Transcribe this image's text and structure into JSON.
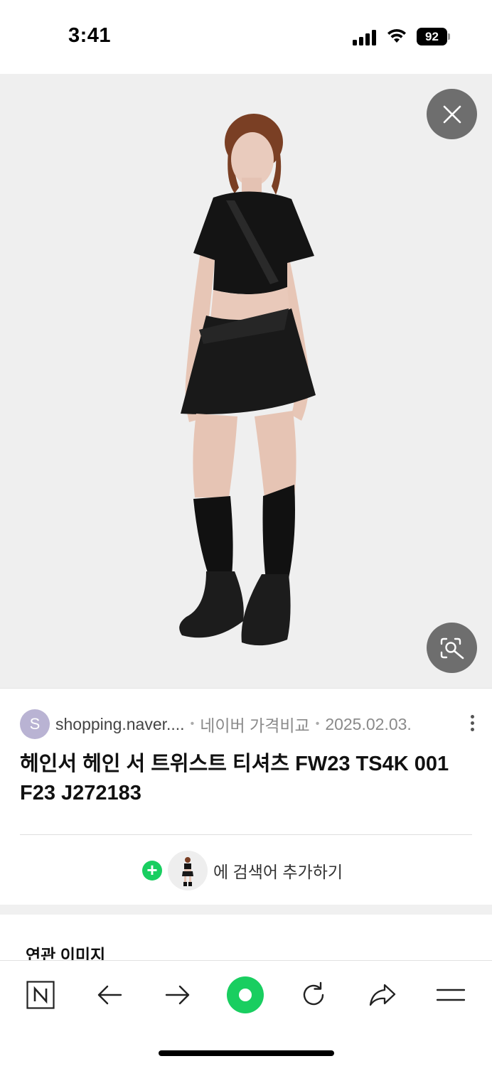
{
  "status_bar": {
    "time": "3:41",
    "battery": "92",
    "icons": [
      "signal-icon",
      "wifi-icon",
      "battery-icon"
    ]
  },
  "viewer": {
    "close_icon": "close-icon",
    "lens_icon": "image-search-icon"
  },
  "result": {
    "source_initial": "S",
    "source_domain": "shopping.naver....",
    "separator": "•",
    "source_name": "네이버 가격비교",
    "date": "2025.02.03.",
    "title": "헤인서 헤인 서 트위스트 티셔츠 FW23 TS4K 001 F23 J272183",
    "add_keyword_label": "에 검색어 추가하기",
    "plus": "+"
  },
  "related": {
    "title": "연관 이미지"
  },
  "toolbar": {
    "items": [
      "naver-home-icon",
      "back-arrow-icon",
      "forward-arrow-icon",
      "green-dot-icon",
      "refresh-icon",
      "share-icon",
      "menu-icon"
    ],
    "home_letter": "N"
  },
  "colors": {
    "accent_green": "#19ce60",
    "image_bg": "#efefef",
    "overlay_button": "#6e6e6e",
    "avatar": "#b9b3d3"
  }
}
